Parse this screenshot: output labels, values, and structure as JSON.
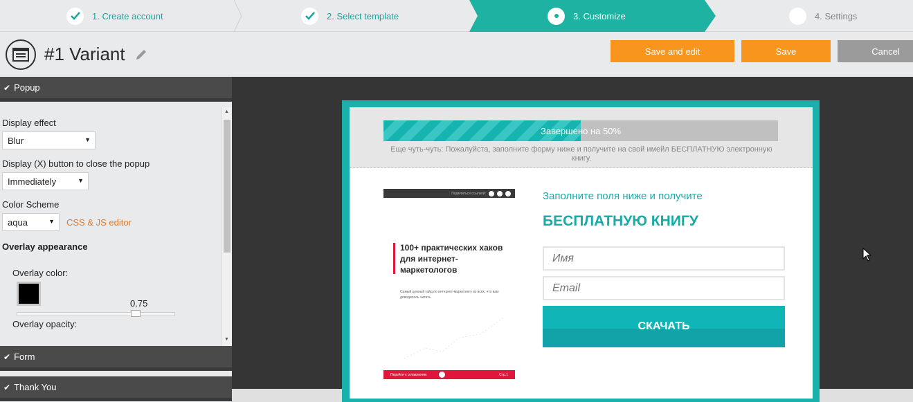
{
  "wizard": {
    "steps": [
      {
        "label": "1. Create account",
        "state": "done"
      },
      {
        "label": "2. Select template",
        "state": "done"
      },
      {
        "label": "3. Customize",
        "state": "active"
      },
      {
        "label": "4. Settings",
        "state": "upcoming"
      }
    ]
  },
  "header": {
    "title": "#1 Variant",
    "save_edit_label": "Save and edit",
    "save_label": "Save",
    "cancel_label": "Cancel"
  },
  "panel": {
    "sections": {
      "popup": "Popup",
      "form": "Form",
      "thank_you": "Thank You"
    },
    "display_effect_label": "Display effect",
    "display_effect_value": "Blur",
    "close_button_label": "Display (X) button to close the popup",
    "close_button_value": "Immediately",
    "color_scheme_label": "Color Scheme",
    "color_scheme_value": "aqua",
    "css_js_link": "CSS & JS editor",
    "overlay_appearance_label": "Overlay appearance",
    "overlay_color_label": "Overlay color:",
    "overlay_color": "#000000",
    "overlay_opacity_label": "Overlay opacity:",
    "overlay_opacity_value": "0.75"
  },
  "popup": {
    "progress": {
      "text": "Завершено на 50%",
      "percent": 50,
      "note": "Еще чуть-чуть: Пожалуйста, заполните форму ниже и получите на свой имейл БЕСПЛАТНУЮ электронную книгу."
    },
    "book": {
      "top_bar_text": "Поделиться ссылкой:",
      "title": "100+ практических хаков для интернет-маркетологов",
      "subtitle": "Самый ценный гайд по интернет-маркетингу из всех, что вам доводилось читать",
      "bottom_left": "Перейти к оглавлению",
      "bottom_right": "Стр.1"
    },
    "form": {
      "heading1": "Заполните поля ниже и получите",
      "heading2": "БЕСПЛАТНУЮ КНИГУ",
      "name_placeholder": "Имя",
      "email_placeholder": "Email",
      "submit_label": "СКАЧАТЬ"
    }
  },
  "colors": {
    "accent": "#1eb2a3",
    "orange": "#f7951d",
    "popup_border": "#19b1aa",
    "book_red": "#e0163d"
  }
}
